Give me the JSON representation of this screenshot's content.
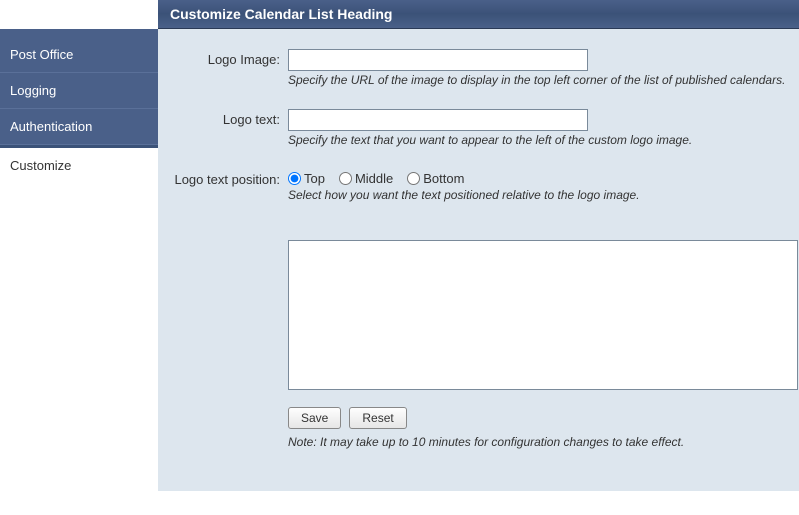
{
  "header": {
    "title": "Customize Calendar List Heading"
  },
  "sidebar": {
    "items": [
      {
        "label": "Post Office"
      },
      {
        "label": "Logging"
      },
      {
        "label": "Authentication"
      },
      {
        "label": "Customize"
      }
    ],
    "activeIndex": 3
  },
  "form": {
    "logoImage": {
      "label": "Logo Image:",
      "value": "",
      "help": "Specify the URL of the image to display in the top left corner of the list of published calendars."
    },
    "logoText": {
      "label": "Logo text:",
      "value": "",
      "help": "Specify the text that you want to appear to the left of the custom logo image."
    },
    "logoPosition": {
      "label": "Logo text position:",
      "options": [
        "Top",
        "Middle",
        "Bottom"
      ],
      "selected": "Top",
      "help": "Select how you want the text positioned relative to the logo image."
    },
    "textarea": {
      "value": ""
    },
    "buttons": {
      "save": "Save",
      "reset": "Reset"
    },
    "note": "Note: It may take up to 10 minutes for configuration changes to take effect."
  }
}
